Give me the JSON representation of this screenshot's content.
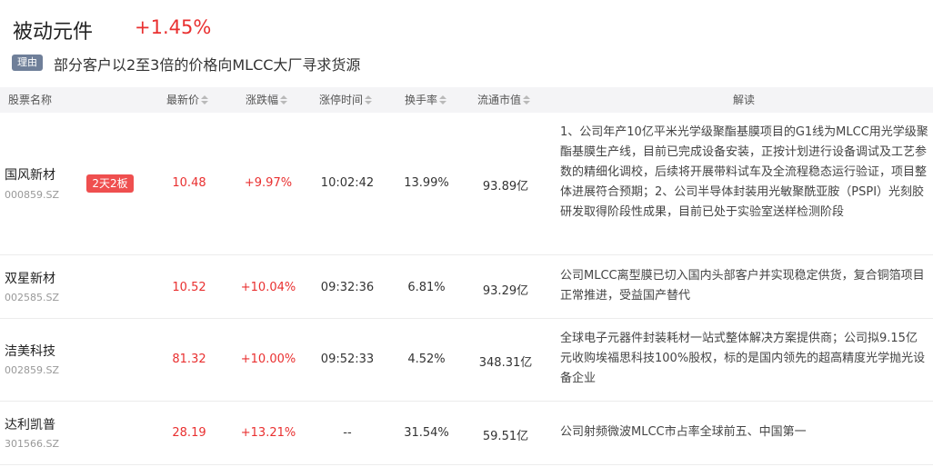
{
  "header": {
    "sector_name": "被动元件",
    "sector_change": "+1.45%",
    "reason_tag": "理由",
    "reason_text": "部分客户以2至3倍的价格向MLCC大厂寻求货源"
  },
  "table": {
    "columns": [
      "股票名称",
      "最新价",
      "涨跌幅",
      "涨停时间",
      "换手率",
      "流通市值",
      "解读"
    ],
    "rows": [
      {
        "name": "国风新材",
        "code": "000859.SZ",
        "tag": "2天2板",
        "price": "10.48",
        "change": "+9.97%",
        "limit_time": "10:02:42",
        "turnover": "13.99%",
        "market_cap": "93.89亿",
        "description": "1、公司年产10亿平米光学级聚酯基膜项目的G1线为MLCC用光学级聚酯基膜生产线，目前已完成设备安装，正按计划进行设备调试及工艺参数的精细化调校，后续将开展带料试车及全流程稳态运行验证，项目整体进展符合预期；2、公司半导体封装用光敏聚酰亚胺（PSPI）光刻胶研发取得阶段性成果，目前已处于实验室送样检测阶段"
      },
      {
        "name": "双星新材",
        "code": "002585.SZ",
        "tag": "",
        "price": "10.52",
        "change": "+10.04%",
        "limit_time": "09:32:36",
        "turnover": "6.81%",
        "market_cap": "93.29亿",
        "description": "公司MLCC离型膜已切入国内头部客户并实现稳定供货，复合铜箔项目正常推进，受益国产替代"
      },
      {
        "name": "洁美科技",
        "code": "002859.SZ",
        "tag": "",
        "price": "81.32",
        "change": "+10.00%",
        "limit_time": "09:52:33",
        "turnover": "4.52%",
        "market_cap": "348.31亿",
        "description": "全球电子元器件封装耗材一站式整体解决方案提供商；公司拟9.15亿元收购埃福思科技100%股权，标的是国内领先的超高精度光学抛光设备企业"
      },
      {
        "name": "达利凯普",
        "code": "301566.SZ",
        "tag": "",
        "price": "28.19",
        "change": "+13.21%",
        "limit_time": "--",
        "turnover": "31.54%",
        "market_cap": "59.51亿",
        "description": "公司射频微波MLCC市占率全球前五、中国第一"
      }
    ]
  }
}
